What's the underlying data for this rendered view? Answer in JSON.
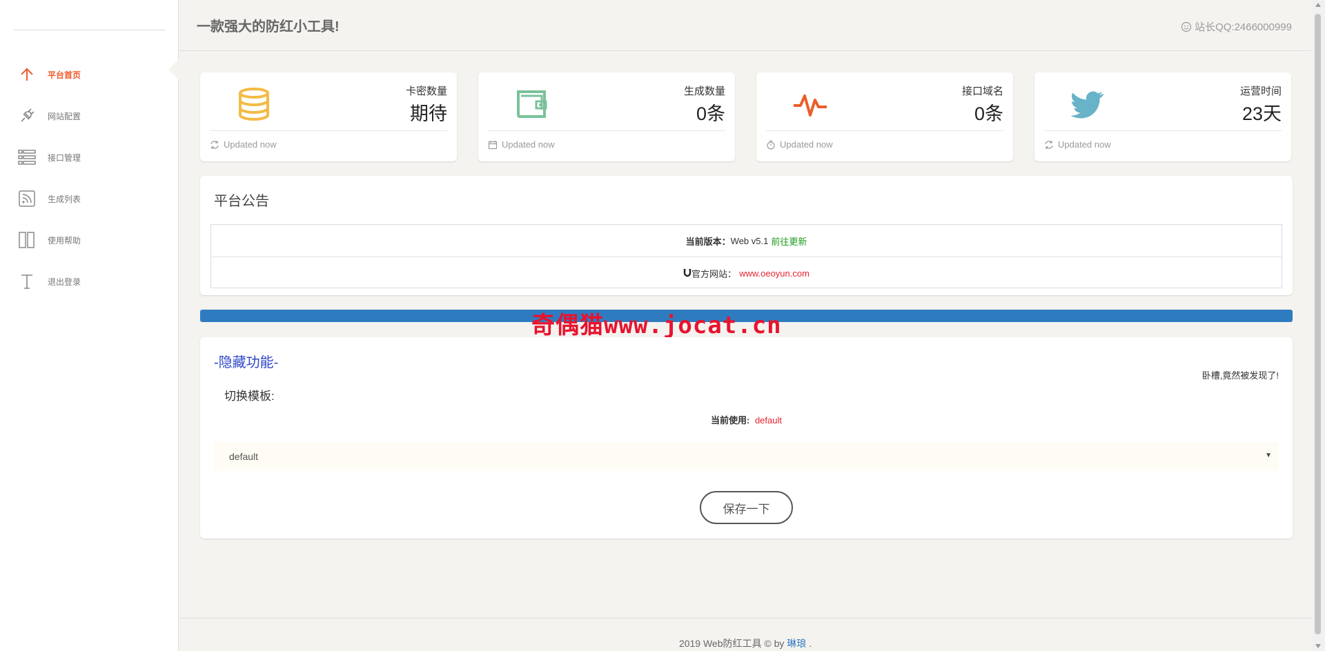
{
  "header": {
    "title": "一款强大的防红小工具!",
    "qq": "站长QQ:2466000999"
  },
  "sidebar": {
    "items": [
      {
        "label": "平台首页",
        "icon": "arrow-up-icon",
        "active": true
      },
      {
        "label": "网站配置",
        "icon": "plug-icon",
        "active": false
      },
      {
        "label": "接口管理",
        "icon": "list-icon",
        "active": false
      },
      {
        "label": "生成列表",
        "icon": "rss-icon",
        "active": false
      },
      {
        "label": "使用帮助",
        "icon": "book-icon",
        "active": false
      },
      {
        "label": "退出登录",
        "icon": "text-t-icon",
        "active": false
      }
    ]
  },
  "stats": [
    {
      "label": "卡密数量",
      "value": "期待",
      "footer": "Updated now",
      "icon": "database-icon",
      "icon_color": "#f3bb45",
      "footer_icon": "refresh-icon"
    },
    {
      "label": "生成数量",
      "value": "0条",
      "footer": "Updated now",
      "icon": "wallet-icon",
      "icon_color": "#7ac29a",
      "footer_icon": "calendar-icon"
    },
    {
      "label": "接口域名",
      "value": "0条",
      "footer": "Updated now",
      "icon": "pulse-icon",
      "icon_color": "#eb5e28",
      "footer_icon": "timer-icon"
    },
    {
      "label": "运营时间",
      "value": "23天",
      "footer": "Updated now",
      "icon": "twitter-icon",
      "icon_color": "#68b3c8",
      "footer_icon": "refresh-icon"
    }
  ],
  "notice": {
    "title": "平台公告",
    "version_label": "当前版本：",
    "version_value": "Web v5.1",
    "version_link": "前往更新",
    "site_label": "官方网站：",
    "site_link": "www.oeoyun.com"
  },
  "watermark": {
    "cn": "奇偶猫",
    "en": "www.jocat.cn"
  },
  "hidden": {
    "title": "-隐藏功能-",
    "note": "卧槽,竟然被发现了!",
    "switch_label": "切换模板:",
    "current_label": "当前使用:",
    "current_value": "default",
    "select_value": "default",
    "save_label": "保存一下"
  },
  "footer": {
    "text": "2019 Web防红工具 © by ",
    "author": "琳琅",
    "suffix": " ."
  },
  "colors": {
    "accent": "#ef5a2c",
    "blue_bar": "#2f7bc0",
    "link_green": "#1a9b1a",
    "link_red": "#e5232f"
  }
}
